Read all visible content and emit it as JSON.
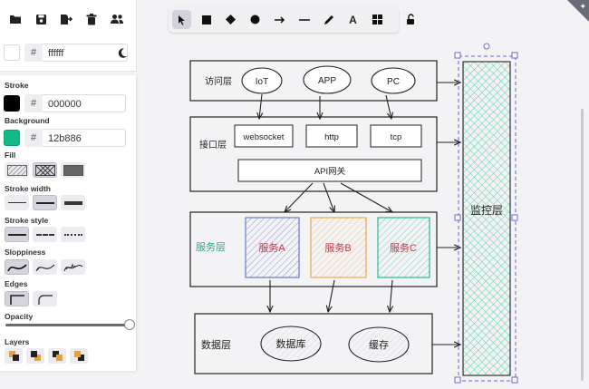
{
  "stroke": {
    "label": "Stroke",
    "hash": "#",
    "value": "000000",
    "color": "#000000"
  },
  "background": {
    "label": "Background",
    "hash": "#",
    "value": "12b886",
    "color": "#12b886"
  },
  "canvas_bg": {
    "hash": "#",
    "value": "ffffff",
    "color": "#ffffff"
  },
  "sections": {
    "fill": "Fill",
    "stroke_width": "Stroke width",
    "stroke_style": "Stroke style",
    "sloppiness": "Sloppiness",
    "edges": "Edges",
    "opacity": "Opacity",
    "layers": "Layers"
  },
  "opacity_level": 1.0,
  "toolbar": {
    "text_tool_glyph": "A"
  },
  "diagram": {
    "access_layer": "访问层",
    "access_nodes": [
      "IoT",
      "APP",
      "PC"
    ],
    "interface_layer": "接口层",
    "interface_nodes": [
      "websocket",
      "http",
      "tcp"
    ],
    "gateway": "API网关",
    "service_layer": "服务层",
    "services": [
      "服务A",
      "服务B",
      "服务C"
    ],
    "data_layer": "数据层",
    "data_nodes": [
      "数据库",
      "缓存"
    ],
    "monitor_layer": "监控层"
  },
  "colors": {
    "accent": "#12b886",
    "service_a": "#5c6fc7",
    "service_b": "#e8a23a",
    "service_c": "#12b886",
    "service_text": "#c2384a"
  }
}
